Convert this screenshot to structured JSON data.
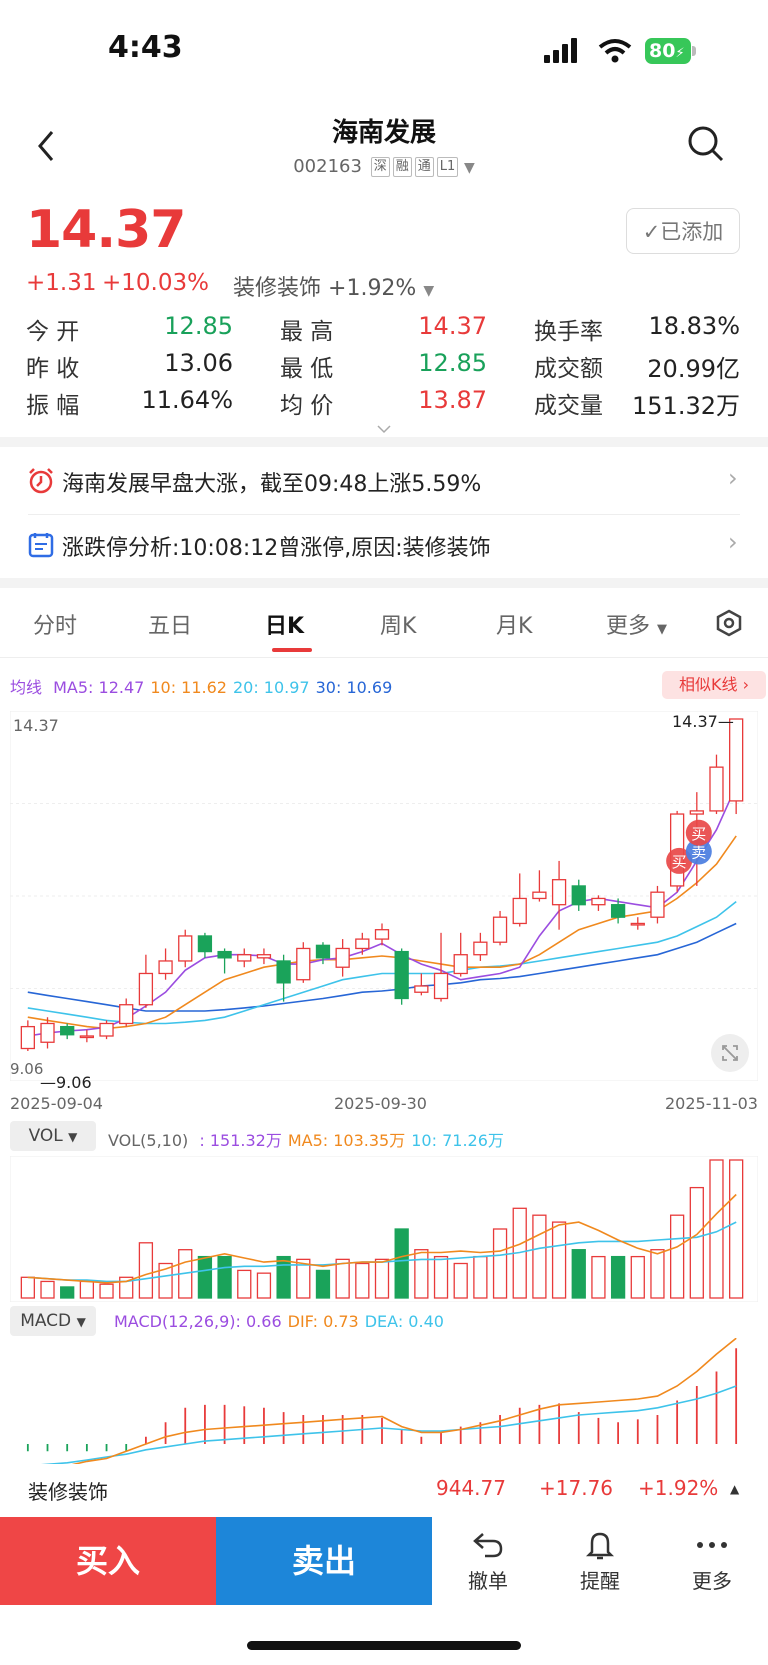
{
  "status_bar": {
    "time": "4:43",
    "battery": "80"
  },
  "header": {
    "title": "海南发展",
    "code": "002163",
    "tags": [
      "深",
      "融",
      "通",
      "L1"
    ]
  },
  "quote": {
    "price": "14.37",
    "change": "+1.31",
    "change_pct": "+10.03%",
    "sector_name": "装修装饰",
    "sector_change": "+1.92%",
    "added_label": "已添加",
    "rows": [
      [
        {
          "label": "今 开",
          "value": "12.85",
          "color": "green"
        },
        {
          "label": "最 高",
          "value": "14.37",
          "color": "red"
        },
        {
          "label": "换手率",
          "value": "18.83%",
          "color": "dark"
        }
      ],
      [
        {
          "label": "昨 收",
          "value": "13.06",
          "color": "dark"
        },
        {
          "label": "最 低",
          "value": "12.85",
          "color": "green"
        },
        {
          "label": "成交额",
          "value": "20.99亿",
          "color": "dark"
        }
      ],
      [
        {
          "label": "振 幅",
          "value": "11.64%",
          "color": "dark"
        },
        {
          "label": "均 价",
          "value": "13.87",
          "color": "red"
        },
        {
          "label": "成交量",
          "value": "151.32万",
          "color": "dark"
        }
      ]
    ]
  },
  "news": [
    {
      "text": "海南发展早盘大涨，截至09:48上涨5.59%",
      "icon": "alarm-icon"
    },
    {
      "text": "涨跌停分析:10:08:12曾涨停,原因:装修装饰",
      "icon": "calendar-icon"
    }
  ],
  "tabs": [
    "分时",
    "五日",
    "日K",
    "周K",
    "月K",
    "更多"
  ],
  "active_tab": 2,
  "ma_legend": {
    "label": "均线",
    "items": [
      {
        "text": "MA5: 12.47",
        "color": "#9b4de0"
      },
      {
        "text": "10: 11.62",
        "color": "#f0891e"
      },
      {
        "text": "20: 10.97",
        "color": "#3ec3ea"
      },
      {
        "text": "30: 10.69",
        "color": "#2766d6"
      }
    ]
  },
  "similar_label": "相似K线",
  "kline_axis": {
    "high_label": "14.37",
    "high_mark": "14.37",
    "low_mark": "9.06",
    "low_left": "9.06",
    "dates": [
      "2025-09-04",
      "2025-09-30",
      "2025-11-03"
    ]
  },
  "markers": {
    "buy": "买",
    "sell": "卖"
  },
  "vol_legend": {
    "dropdown": "VOL",
    "name": "VOL(5,10)",
    "items": [
      {
        "text": ": 151.32万",
        "color": "#9b4de0"
      },
      {
        "text": "MA5: 103.35万",
        "color": "#f0891e"
      },
      {
        "text": "10: 71.26万",
        "color": "#3ec3ea"
      }
    ]
  },
  "macd_legend": {
    "dropdown": "MACD",
    "items": [
      {
        "text": "MACD(12,26,9): 0.66",
        "color": "#9b4de0"
      },
      {
        "text": "DIF: 0.73",
        "color": "#f0891e"
      },
      {
        "text": "DEA: 0.40",
        "color": "#3ec3ea"
      }
    ]
  },
  "bottom_sector": {
    "name": "装修装饰",
    "value": "944.77",
    "change": "+17.76",
    "pct": "+1.92%"
  },
  "actions": {
    "buy": "买入",
    "sell": "卖出",
    "cancel": "撤单",
    "alert": "提醒",
    "more": "更多"
  },
  "chart_data": {
    "type": "candlestick",
    "x_range": [
      "2025-09-04",
      "2025-11-03"
    ],
    "ohlc": [
      [
        9.1,
        9.45,
        9.55,
        9.06
      ],
      [
        9.2,
        9.5,
        9.6,
        9.1
      ],
      [
        9.45,
        9.32,
        9.5,
        9.25
      ],
      [
        9.3,
        9.3,
        9.4,
        9.2
      ],
      [
        9.3,
        9.5,
        9.55,
        9.25
      ],
      [
        9.5,
        9.8,
        9.9,
        9.45
      ],
      [
        9.8,
        10.3,
        10.6,
        9.75
      ],
      [
        10.3,
        10.5,
        10.7,
        10.2
      ],
      [
        10.5,
        10.9,
        11.0,
        10.4
      ],
      [
        10.9,
        10.65,
        10.95,
        10.55
      ],
      [
        10.65,
        10.55,
        10.7,
        10.3
      ],
      [
        10.5,
        10.6,
        10.7,
        10.4
      ],
      [
        10.55,
        10.6,
        10.7,
        10.45
      ],
      [
        10.5,
        10.15,
        10.6,
        9.85
      ],
      [
        10.2,
        10.7,
        10.8,
        10.15
      ],
      [
        10.75,
        10.55,
        10.8,
        10.45
      ],
      [
        10.4,
        10.7,
        10.85,
        10.25
      ],
      [
        10.7,
        10.85,
        10.95,
        10.6
      ],
      [
        10.85,
        11.0,
        11.1,
        10.75
      ],
      [
        10.65,
        9.9,
        10.7,
        9.8
      ],
      [
        10.0,
        10.1,
        10.3,
        9.95
      ],
      [
        9.9,
        10.3,
        10.95,
        9.85
      ],
      [
        10.3,
        10.6,
        10.95,
        10.25
      ],
      [
        10.6,
        10.8,
        10.95,
        10.5
      ],
      [
        10.8,
        11.2,
        11.3,
        10.75
      ],
      [
        11.1,
        11.5,
        11.9,
        11.05
      ],
      [
        11.5,
        11.6,
        11.95,
        11.45
      ],
      [
        11.4,
        11.8,
        12.1,
        11.0
      ],
      [
        11.7,
        11.4,
        11.8,
        11.3
      ],
      [
        11.4,
        11.5,
        11.55,
        11.3
      ],
      [
        11.4,
        11.2,
        11.5,
        11.1
      ],
      [
        11.1,
        11.1,
        11.2,
        11.0
      ],
      [
        11.2,
        11.6,
        11.7,
        11.1
      ],
      [
        11.7,
        12.85,
        12.9,
        11.6
      ],
      [
        12.85,
        12.9,
        13.2,
        11.7
      ],
      [
        12.9,
        13.6,
        13.8,
        12.85
      ],
      [
        13.06,
        14.37,
        14.37,
        12.85
      ]
    ],
    "ma5": [
      9.3,
      9.35,
      9.38,
      9.4,
      9.44,
      9.58,
      9.78,
      10.0,
      10.35,
      10.55,
      10.6,
      10.6,
      10.58,
      10.45,
      10.45,
      10.52,
      10.55,
      10.65,
      10.78,
      10.6,
      10.45,
      10.35,
      10.2,
      10.25,
      10.3,
      10.4,
      10.9,
      11.3,
      11.45,
      11.5,
      11.45,
      11.4,
      11.35,
      11.6,
      12.1,
      12.6,
      13.3
    ],
    "ma10": [
      9.6,
      9.55,
      9.5,
      9.45,
      9.42,
      9.45,
      9.5,
      9.6,
      9.8,
      10.0,
      10.2,
      10.3,
      10.4,
      10.45,
      10.5,
      10.52,
      10.52,
      10.55,
      10.58,
      10.55,
      10.5,
      10.45,
      10.4,
      10.4,
      10.4,
      10.45,
      10.6,
      10.8,
      11.0,
      11.1,
      11.2,
      11.25,
      11.3,
      11.5,
      11.75,
      12.05,
      12.5
    ],
    "ma20": [
      9.75,
      9.7,
      9.65,
      9.6,
      9.55,
      9.52,
      9.5,
      9.5,
      9.52,
      9.55,
      9.6,
      9.7,
      9.8,
      9.9,
      10.0,
      10.1,
      10.2,
      10.25,
      10.3,
      10.3,
      10.3,
      10.3,
      10.35,
      10.4,
      10.42,
      10.45,
      10.5,
      10.55,
      10.6,
      10.65,
      10.7,
      10.75,
      10.8,
      10.9,
      11.05,
      11.2,
      11.45
    ],
    "ma30": [
      10.0,
      9.95,
      9.9,
      9.85,
      9.8,
      9.75,
      9.7,
      9.7,
      9.7,
      9.7,
      9.72,
      9.75,
      9.78,
      9.82,
      9.86,
      9.9,
      9.95,
      10.0,
      10.02,
      10.05,
      10.1,
      10.12,
      10.15,
      10.2,
      10.22,
      10.25,
      10.3,
      10.35,
      10.4,
      10.45,
      10.5,
      10.55,
      10.6,
      10.7,
      10.8,
      10.95,
      11.1
    ],
    "volume": [
      0.15,
      0.12,
      0.08,
      0.12,
      0.1,
      0.15,
      0.4,
      0.25,
      0.35,
      0.3,
      0.3,
      0.2,
      0.18,
      0.3,
      0.28,
      0.2,
      0.28,
      0.25,
      0.28,
      0.5,
      0.35,
      0.3,
      0.25,
      0.3,
      0.5,
      0.65,
      0.6,
      0.55,
      0.35,
      0.3,
      0.3,
      0.3,
      0.35,
      0.6,
      0.8,
      1.0,
      1.0
    ],
    "vol_ma5": [
      0.15,
      0.14,
      0.13,
      0.12,
      0.11,
      0.12,
      0.17,
      0.21,
      0.26,
      0.29,
      0.32,
      0.29,
      0.26,
      0.27,
      0.25,
      0.23,
      0.25,
      0.26,
      0.26,
      0.3,
      0.33,
      0.33,
      0.34,
      0.33,
      0.34,
      0.39,
      0.46,
      0.53,
      0.55,
      0.49,
      0.42,
      0.36,
      0.32,
      0.37,
      0.46,
      0.61,
      0.75
    ],
    "vol_ma10": [
      0.15,
      0.14,
      0.13,
      0.13,
      0.12,
      0.12,
      0.14,
      0.16,
      0.18,
      0.2,
      0.22,
      0.23,
      0.23,
      0.24,
      0.24,
      0.24,
      0.25,
      0.26,
      0.26,
      0.27,
      0.28,
      0.28,
      0.29,
      0.3,
      0.31,
      0.33,
      0.36,
      0.38,
      0.4,
      0.41,
      0.41,
      0.41,
      0.42,
      0.43,
      0.44,
      0.48,
      0.55
    ],
    "macd_bars": [
      -0.05,
      -0.05,
      -0.05,
      -0.05,
      -0.05,
      -0.05,
      0.05,
      0.15,
      0.25,
      0.27,
      0.27,
      0.26,
      0.25,
      0.22,
      0.2,
      0.2,
      0.2,
      0.2,
      0.18,
      0.1,
      0.05,
      0.08,
      0.12,
      0.15,
      0.2,
      0.25,
      0.27,
      0.28,
      0.22,
      0.18,
      0.15,
      0.17,
      0.2,
      0.3,
      0.4,
      0.5,
      0.66
    ],
    "dif": [
      -0.2,
      -0.18,
      -0.15,
      -0.12,
      -0.1,
      -0.05,
      0.0,
      0.05,
      0.08,
      0.1,
      0.11,
      0.12,
      0.13,
      0.14,
      0.15,
      0.16,
      0.17,
      0.18,
      0.19,
      0.12,
      0.08,
      0.08,
      0.1,
      0.13,
      0.16,
      0.2,
      0.24,
      0.27,
      0.28,
      0.29,
      0.3,
      0.31,
      0.33,
      0.4,
      0.5,
      0.62,
      0.73
    ],
    "dea": [
      -0.15,
      -0.14,
      -0.13,
      -0.11,
      -0.09,
      -0.07,
      -0.04,
      -0.02,
      0.0,
      0.02,
      0.03,
      0.04,
      0.05,
      0.06,
      0.07,
      0.08,
      0.09,
      0.1,
      0.11,
      0.1,
      0.09,
      0.09,
      0.1,
      0.11,
      0.12,
      0.14,
      0.16,
      0.18,
      0.2,
      0.21,
      0.22,
      0.23,
      0.25,
      0.28,
      0.31,
      0.35,
      0.4
    ]
  }
}
